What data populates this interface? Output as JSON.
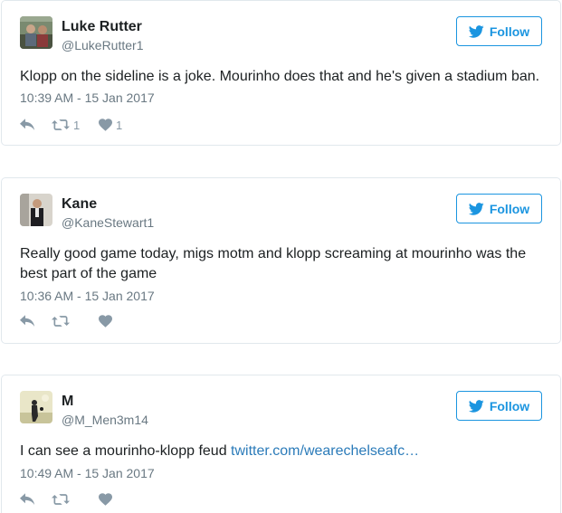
{
  "tweets": [
    {
      "name": "Luke Rutter",
      "handle": "@LukeRutter1",
      "follow_label": "Follow",
      "text": "Klopp on the sideline is a joke. Mourinho does that and he's given a stadium ban.",
      "link": "",
      "timestamp": "10:39 AM - 15 Jan 2017",
      "retweets": "1",
      "likes": "1"
    },
    {
      "name": "Kane",
      "handle": "@KaneStewart1",
      "follow_label": "Follow",
      "text": "Really good game today, migs motm and klopp screaming at mourinho was the best part of the game",
      "link": "",
      "timestamp": "10:36 AM - 15 Jan 2017",
      "retweets": "",
      "likes": ""
    },
    {
      "name": "M",
      "handle": "@M_Men3m14",
      "follow_label": "Follow",
      "text": "I can see a mourinho-klopp feud ",
      "link": "twitter.com/wearechelseafc…",
      "timestamp": "10:49 AM - 15 Jan 2017",
      "retweets": "",
      "likes": ""
    }
  ],
  "colors": {
    "accent": "#1b95e0",
    "link": "#2b7bb9",
    "muted": "#697882",
    "icon": "#8899a6",
    "border": "#e1e8ed"
  },
  "icons": {
    "follow": "twitter-bird-icon",
    "reply": "reply-icon",
    "retweet": "retweet-icon",
    "like": "heart-icon"
  }
}
